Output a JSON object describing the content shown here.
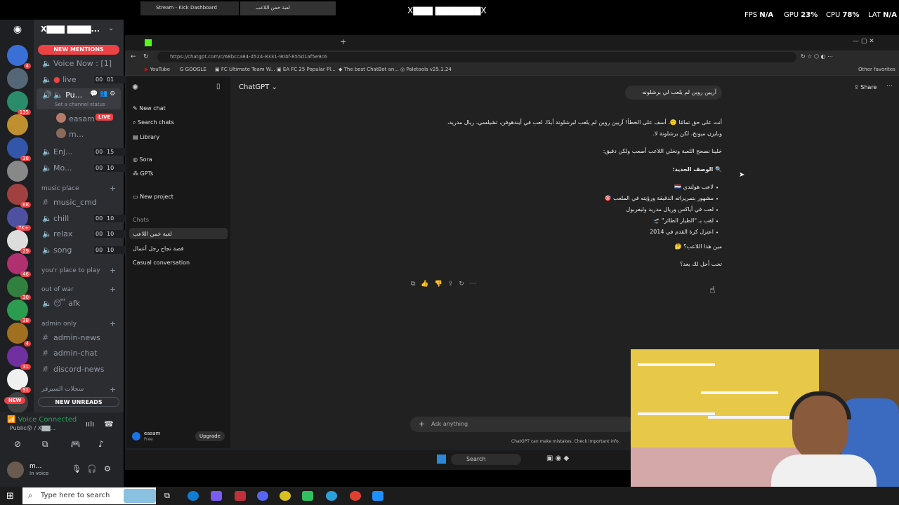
{
  "stream_title": "X▇▇▇ ▇▇▇▇▇▇▇X",
  "stats": {
    "fps_label": "FPS",
    "fps_value": "N/A",
    "gpu_label": "GPU",
    "gpu_value": "23%",
    "cpu_label": "CPU",
    "cpu_value": "78%",
    "lat_label": "LAT",
    "lat_value": "N/A"
  },
  "discord": {
    "server_name": "X▇▇▇ ▇▇▇▇...",
    "new_mentions": "NEW MENTIONS",
    "new_unreads": "NEW UNREADS",
    "new_label": "NEW",
    "server_badges": [
      "4",
      "",
      "135",
      "",
      "38",
      "",
      "68",
      "7K+",
      "29",
      "46",
      "30",
      "38",
      "4",
      "31",
      "91",
      ""
    ],
    "channels": {
      "voice_now": "Voice Now : [1]",
      "live": "live",
      "live_counts": [
        "00",
        "01"
      ],
      "pu": "Pu...",
      "set_status": "Set a channel status",
      "user_easam": "easam",
      "live_badge": "LIVE",
      "user_m": "m...",
      "enj": "Enj...",
      "enj_counts": [
        "00",
        "15"
      ],
      "mo": "Mo...",
      "mo_counts": [
        "00",
        "10"
      ],
      "music_place": "music place",
      "music_cmd": "music_cmd",
      "chill": "chill",
      "chill_counts": [
        "00",
        "10"
      ],
      "relax": "relax",
      "relax_counts": [
        "00",
        "10"
      ],
      "song": "song",
      "song_counts": [
        "00",
        "10"
      ],
      "youre_place": "you'r place to play",
      "out_of_war": "out of war",
      "afk": "afk",
      "admin_only": "admin only",
      "admin_news": "admin-news",
      "admin_chat": "admin-chat",
      "discord_news": "discord-news",
      "arabic_cat": "سجلات السيرفر"
    },
    "voice_connected": "Voice Connected",
    "voice_sub": "Public😮 / X▇▇...",
    "user_name": "m...",
    "user_status": "In voice"
  },
  "browser": {
    "tab1": "Stream - Kick Dashboard",
    "tab2": "لعبة خمن اللاعب",
    "url": "https://chatgpt.com/c/68bcca84-d524-8331-90bf-855d1af5e9c6",
    "bookmarks": [
      "YouTube",
      "GOOGLE",
      "FC Ultimate Team W...",
      "EA FC 25 Popular Pl...",
      "The best ChatBot an...",
      "Paletools v25.1.24"
    ],
    "other_favorites": "Other favorites"
  },
  "chatgpt": {
    "model": "ChatGPT",
    "share": "Share",
    "nav": [
      "New chat",
      "Search chats",
      "Library",
      "Sora",
      "GPTs",
      "New project"
    ],
    "chats_label": "Chats",
    "chats": [
      "لعبة خمن اللاعب",
      "قصة نجاح رجل أعمال",
      "Casual conversation"
    ],
    "user_name": "easam",
    "user_plan": "Free",
    "upgrade": "Upgrade",
    "user_msg": "آريين روبن لم يلعب لي برشلونه",
    "reply": [
      "أنت على حق تمامًا 🙂، أسف على الخطأ! آريين روبن لم يلعب لبرشلونة أبدًا. لعب في أيندهوفن، تشيلسي، ريال مدريد،",
      "وبايرن ميونخ، لكن برشلونة لا.",
      "خلينا نصحح اللعبة ونخلي اللاعب أصعب ولكن دقيق:",
      "🔍 الوصف الجديد:",
      "لاعب هولندي 🇳🇱",
      "مشهور بتمريراته الدقيقة ورؤيته في الملعب 🎯",
      "لعب في أياكس وريال مدريد وليفربول",
      "لقب بـ \"الطيار الطائر\" 🛫",
      "اعتزل كرة القدم في 2014",
      "مين هذا اللاعب؟ 🤔",
      "تحب أحل لك بعد؟"
    ],
    "input_placeholder": "Ask anything",
    "disclaimer": "ChatGPT can make mistakes. Check important info."
  },
  "inner_taskbar": {
    "search": "Search"
  },
  "taskbar": {
    "search_placeholder": "Type here to search"
  }
}
